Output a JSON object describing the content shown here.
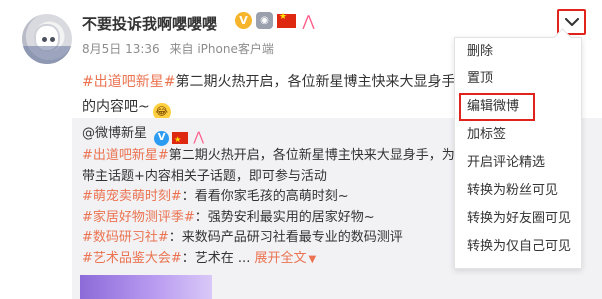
{
  "post": {
    "username": "不要投诉我啊嚶嚶嚶",
    "date": "8月5日 13:36",
    "source": "来自 iPhone客户端",
    "text_tag": "#出道吧新星#",
    "text_body": "第二期火热开启，各位新星博主快来大显身手",
    "text_line2": "的内容吧~",
    "emoji_name": "laughing-tears-emoji"
  },
  "repost": {
    "author": "@微博新星",
    "line1_tag": "#出道吧新星#",
    "line1_text": "第二期火热开启，各位新星博主快来大显身手，为大家呈",
    "line2": "带主话题+内容相关子话题，即可参与活动",
    "items": [
      {
        "tag": "#萌宠卖萌时刻#",
        "text": "：看看你家毛孩的高萌时刻~"
      },
      {
        "tag": "#家居好物测评季#",
        "text": "：强势安利最实用的居家好物~"
      },
      {
        "tag": "#数码研习社#",
        "text": "：来数码产品研习社看最专业的数码测评"
      },
      {
        "tag": "#艺术品鉴大会#",
        "text": "：艺术在 ..."
      }
    ],
    "expand_label": "展开全文",
    "expand_icon": "chevron-down-icon"
  },
  "menu": {
    "items": [
      {
        "label": "删除"
      },
      {
        "label": "置顶"
      },
      {
        "label": "编辑微博"
      },
      {
        "label": "加标签"
      },
      {
        "label": "开启评论精选"
      },
      {
        "label": "转换为粉丝可见"
      },
      {
        "label": "转换为好友圈可见"
      },
      {
        "label": "转换为仅自己可见"
      }
    ]
  },
  "colors": {
    "accent_orange": "#eb7350",
    "highlight_red": "#e0231b",
    "meta_gray": "#8c8c8c",
    "repost_bg": "#f2f2f5"
  }
}
